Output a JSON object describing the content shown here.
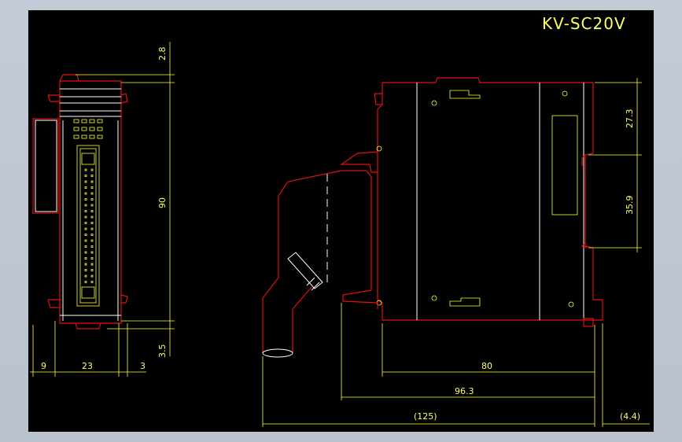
{
  "title": "KV-SC20V",
  "colors": {
    "background": "#000000",
    "outline": "#e01010",
    "edges": "#ffffff",
    "dimension": "#ffff33",
    "frame": "#bcc5d0"
  },
  "dimensions": {
    "top_gap": "2.8",
    "height": "90",
    "bottom_gap": "3.5",
    "side_depth": "9",
    "width": "23",
    "latch": "3",
    "upper_height": "27.3",
    "slot_height": "35.9",
    "body_depth": "80",
    "with_connector": "96.3",
    "total": "(125)",
    "offset": "(4.4)"
  }
}
